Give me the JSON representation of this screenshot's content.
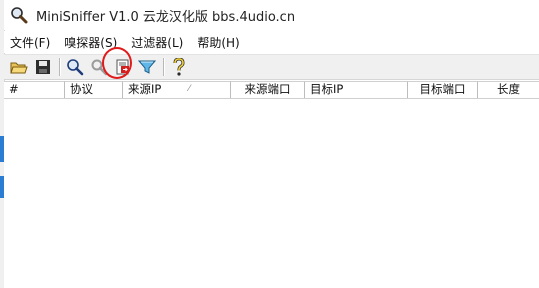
{
  "window": {
    "title": "MiniSniffer V1.0 云龙汉化版 bbs.4udio.cn"
  },
  "menu": {
    "items": [
      {
        "label": "文件(F)"
      },
      {
        "label": "嗅探器(S)"
      },
      {
        "label": "过滤器(L)"
      },
      {
        "label": "帮助(H)"
      }
    ]
  },
  "toolbar": {
    "buttons": [
      {
        "icon": "open-folder-icon"
      },
      {
        "icon": "save-disk-icon"
      },
      {
        "icon": "search-icon"
      },
      {
        "icon": "tools-icon"
      },
      {
        "icon": "export-icon"
      },
      {
        "icon": "filter-icon"
      },
      {
        "icon": "help-icon"
      }
    ],
    "highlighted": "export-icon",
    "highlight_color": "#e01b1b"
  },
  "table": {
    "columns": [
      {
        "label": "#"
      },
      {
        "label": "协议"
      },
      {
        "label": "来源IP"
      },
      {
        "label": "来源端口"
      },
      {
        "label": "目标IP"
      },
      {
        "label": "目标端口"
      },
      {
        "label": "长度"
      }
    ],
    "sort_indicator": "⁄",
    "rows": []
  }
}
